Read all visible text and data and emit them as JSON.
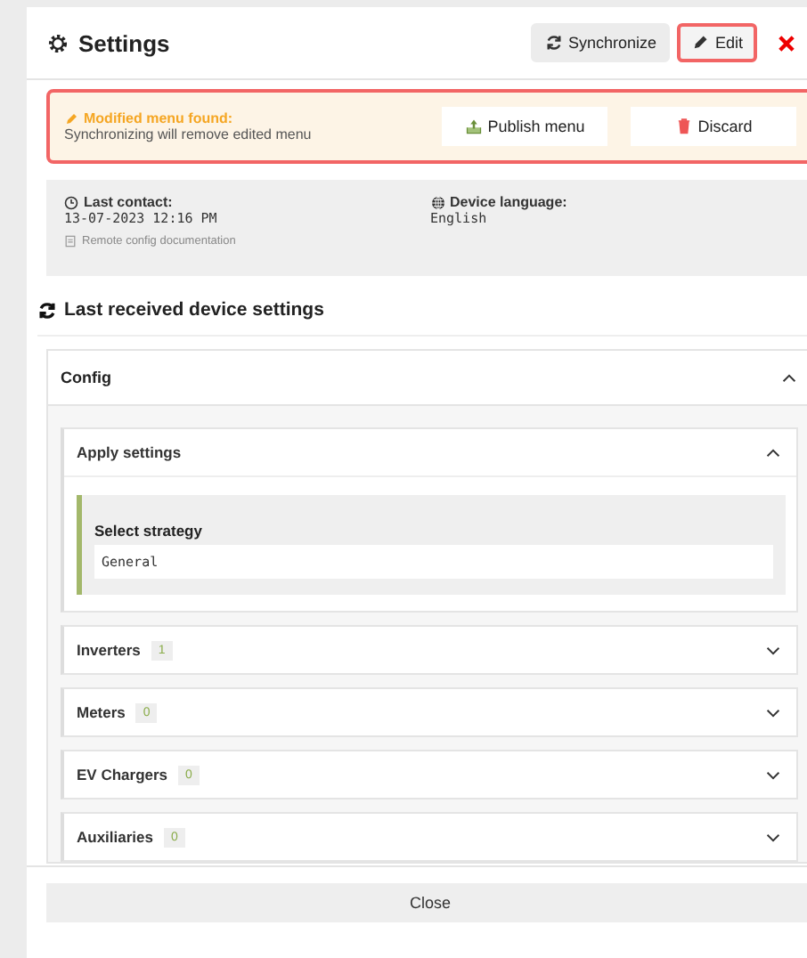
{
  "header": {
    "title": "Settings",
    "buttons": [
      {
        "label": "Synchronize",
        "kind": "sync",
        "selected": false
      },
      {
        "label": "Edit",
        "kind": "edit",
        "selected": true
      }
    ]
  },
  "alert": {
    "title": "Modified menu found:",
    "message": "Synchronizing will remove edited menu",
    "actions": [
      {
        "label": "Publish menu",
        "kind": "publish"
      },
      {
        "label": "Discard",
        "kind": "discard"
      }
    ]
  },
  "info": {
    "last_contact_label": "Last contact:",
    "last_contact": "13-07-2023 12:16 PM",
    "language_label": "Device language:",
    "language": "English",
    "doc_link": "Remote config documentation"
  },
  "section_title": "Last received device settings",
  "config": {
    "title": "Config",
    "expanded": true,
    "groups": [
      {
        "title": "Apply settings",
        "expanded": true,
        "field_label": "Select strategy",
        "field_value": "General"
      },
      {
        "title": "Inverters",
        "count": "1",
        "expanded": false
      },
      {
        "title": "Meters",
        "count": "0",
        "expanded": false
      },
      {
        "title": "EV Chargers",
        "count": "0",
        "expanded": false
      },
      {
        "title": "Auxiliaries",
        "count": "0",
        "expanded": false
      }
    ]
  },
  "footer": {
    "close": "Close"
  }
}
